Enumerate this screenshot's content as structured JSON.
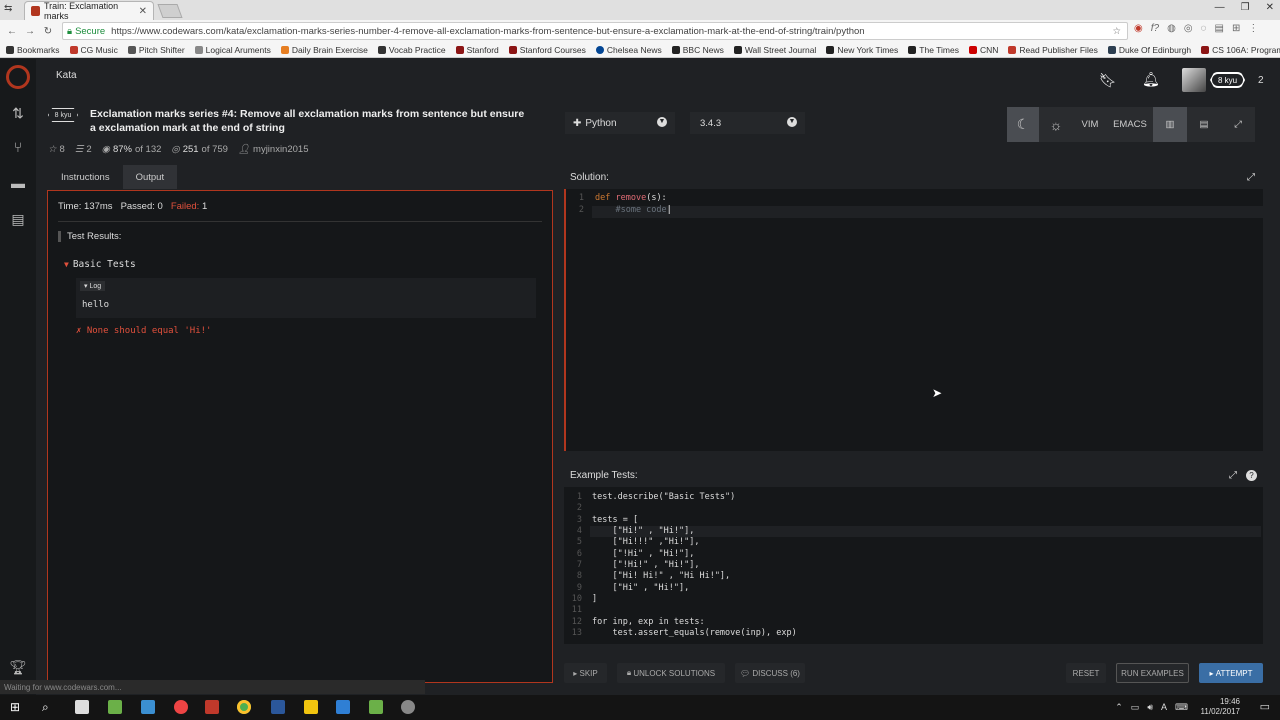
{
  "browser": {
    "tab_title": "Train: Exclamation marks",
    "url": "https://www.codewars.com/kata/exclamation-marks-series-number-4-remove-all-exclamation-marks-from-sentence-but-ensure-a-exclamation-mark-at-the-end-of-string/train/python",
    "secure_label": "Secure",
    "status_url": "Waiting for www.codewars.com..."
  },
  "bookmarks": [
    {
      "label": "Bookmarks",
      "color": "#333"
    },
    {
      "label": "CG Music",
      "color": "#c0392b"
    },
    {
      "label": "Pitch Shifter",
      "color": "#555"
    },
    {
      "label": "Logical Aruments",
      "color": "#888"
    },
    {
      "label": "Daily Brain Exercise",
      "color": "#e67e22"
    },
    {
      "label": "Vocab Practice",
      "color": "#333"
    },
    {
      "label": "Stanford",
      "color": "#8c1515"
    },
    {
      "label": "Stanford Courses",
      "color": "#8c1515"
    },
    {
      "label": "Chelsea News",
      "color": "#034694"
    },
    {
      "label": "BBC News",
      "color": "#222"
    },
    {
      "label": "Wall Street Journal",
      "color": "#222"
    },
    {
      "label": "New York Times",
      "color": "#222"
    },
    {
      "label": "The Times",
      "color": "#222"
    },
    {
      "label": "CNN",
      "color": "#cc0000"
    },
    {
      "label": "Read Publisher Files",
      "color": "#c0392b"
    },
    {
      "label": "Duke Of Edinburgh",
      "color": "#2c3e50"
    },
    {
      "label": "CS 106A: Programmin",
      "color": "#8c1515"
    }
  ],
  "header": {
    "section": "Kata",
    "user_rank": "8 kyu",
    "honor": "2"
  },
  "kata": {
    "rank": "8 kyu",
    "title": "Exclamation marks series #4: Remove all exclamation marks from sentence but ensure a exclamation mark at the end of string",
    "stars": "8",
    "collections": "2",
    "satisfaction": "87%",
    "satisfaction_of": "of 132",
    "completed": "251",
    "completed_of": "of 759",
    "author": "myjinxin2015"
  },
  "language": "Python",
  "version": "3.4.3",
  "toolbar": {
    "vim": "VIM",
    "emacs": "EMACS"
  },
  "tabs": {
    "instructions": "Instructions",
    "output": "Output"
  },
  "output": {
    "time": "Time: 137ms",
    "passed": "Passed: 0",
    "failed_label": "Failed:",
    "failed_count": "1",
    "results_header": "Test Results:",
    "group": "Basic Tests",
    "log_tag": "Log",
    "log_text": "hello",
    "failure": "None should equal 'Hi!'"
  },
  "solution": {
    "header": "Solution:",
    "lines": [
      "def remove(s):",
      "    #some code"
    ]
  },
  "example_tests": {
    "header": "Example Tests:",
    "lines": [
      "test.describe(\"Basic Tests\")",
      "",
      "tests = [",
      "    [\"Hi!\" , \"Hi!\"],",
      "    [\"Hi!!!\" ,\"Hi!\"],",
      "    [\"!Hi\" , \"Hi!\"],",
      "    [\"!Hi!\" , \"Hi!\"],",
      "    [\"Hi! Hi!\" , \"Hi Hi!\"],",
      "    [\"Hi\" , \"Hi!\"],",
      "]",
      "",
      "for inp, exp in tests:",
      "    test.assert_equals(remove(inp), exp)"
    ]
  },
  "buttons": {
    "skip": "SKIP",
    "unlock": "UNLOCK SOLUTIONS",
    "discuss": "DISCUSS (6)",
    "reset": "RESET",
    "run_examples": "RUN EXAMPLES",
    "attempt": "ATTEMPT"
  },
  "taskbar": {
    "time": "19:46",
    "date": "11/02/2017"
  },
  "colors": {
    "accent": "#b1361e",
    "attempt": "#3a6ea5",
    "failed": "#e0503c"
  }
}
